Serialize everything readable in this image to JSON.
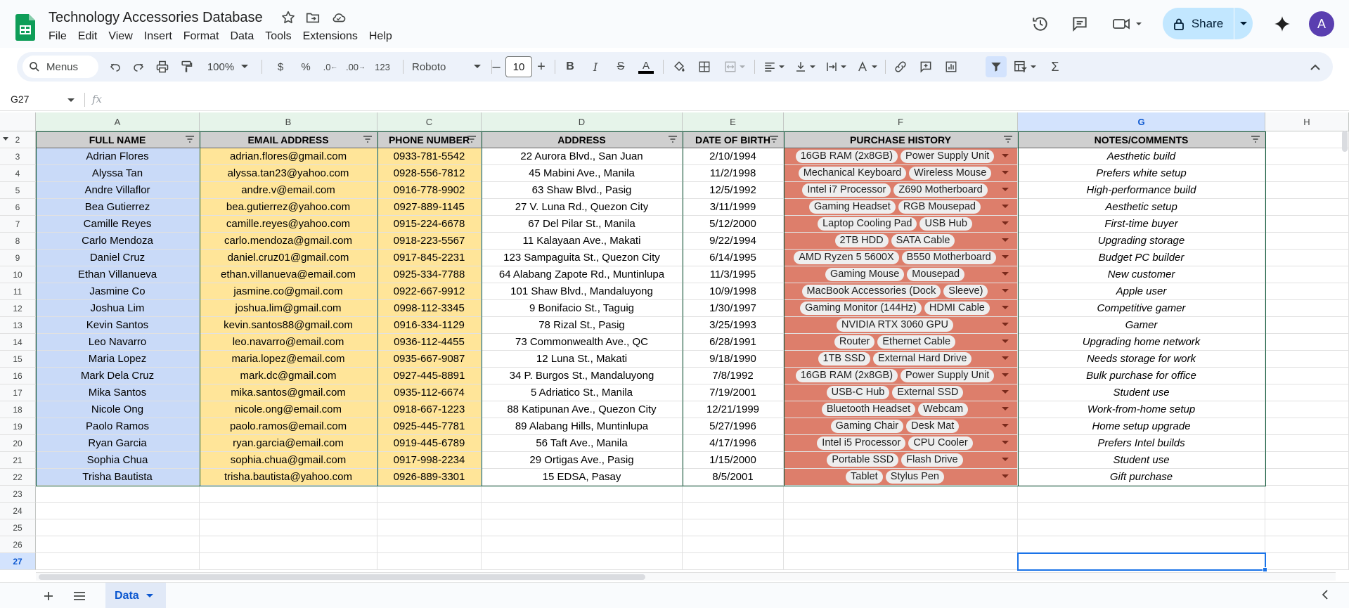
{
  "app": {
    "title": "Technology Accessories Database",
    "menus": [
      "File",
      "Edit",
      "View",
      "Insert",
      "Format",
      "Data",
      "Tools",
      "Extensions",
      "Help"
    ],
    "share_label": "Share",
    "avatar_letter": "A"
  },
  "toolbar": {
    "search_label": "Menus",
    "zoom": "100%",
    "currency": "$",
    "percent": "%",
    "dec_decrease": ".0",
    "dec_increase": ".00",
    "number_format": "123",
    "font": "Roboto",
    "font_size": "10",
    "bold": "B",
    "italic": "I",
    "strike": "S",
    "text_color": "A",
    "sum": "Σ"
  },
  "formula_bar": {
    "name_box": "G27",
    "fx": "fx"
  },
  "grid": {
    "columns": [
      "A",
      "B",
      "C",
      "D",
      "E",
      "F",
      "G",
      "H"
    ],
    "headers": [
      "FULL NAME",
      "EMAIL ADDRESS",
      "PHONE NUMBER",
      "ADDRESS",
      "DATE OF BIRTH",
      "PURCHASE HISTORY",
      "NOTES/COMMENTS"
    ],
    "header_row_number": "2",
    "rows": [
      {
        "num": "3",
        "name": "Adrian Flores",
        "email": "adrian.flores@gmail.com",
        "phone": "0933-781-5542",
        "address": "22 Aurora Blvd., San Juan",
        "dob": "2/10/1994",
        "purchases": [
          "16GB RAM (2x8GB)",
          "Power Supply Unit"
        ],
        "notes": "Aesthetic build"
      },
      {
        "num": "4",
        "name": "Alyssa Tan",
        "email": "alyssa.tan23@yahoo.com",
        "phone": "0928-556-7812",
        "address": "45 Mabini Ave., Manila",
        "dob": "11/2/1998",
        "purchases": [
          "Mechanical Keyboard",
          "Wireless Mouse"
        ],
        "notes": "Prefers white setup"
      },
      {
        "num": "5",
        "name": "Andre Villaflor",
        "email": "andre.v@email.com",
        "phone": "0916-778-9902",
        "address": "63 Shaw Blvd., Pasig",
        "dob": "12/5/1992",
        "purchases": [
          "Intel i7 Processor",
          "Z690 Motherboard"
        ],
        "notes": "High-performance build"
      },
      {
        "num": "6",
        "name": "Bea Gutierrez",
        "email": "bea.gutierrez@yahoo.com",
        "phone": "0927-889-1145",
        "address": "27 V. Luna Rd., Quezon City",
        "dob": "3/11/1999",
        "purchases": [
          "Gaming Headset",
          "RGB Mousepad"
        ],
        "notes": "Aesthetic setup"
      },
      {
        "num": "7",
        "name": "Camille Reyes",
        "email": "camille.reyes@yahoo.com",
        "phone": "0915-224-6678",
        "address": "67 Del Pilar St., Manila",
        "dob": "5/12/2000",
        "purchases": [
          "Laptop Cooling Pad",
          "USB Hub"
        ],
        "notes": "First-time buyer"
      },
      {
        "num": "8",
        "name": "Carlo Mendoza",
        "email": "carlo.mendoza@gmail.com",
        "phone": "0918-223-5567",
        "address": "11 Kalayaan Ave., Makati",
        "dob": "9/22/1994",
        "purchases": [
          "2TB HDD",
          "SATA Cable"
        ],
        "notes": "Upgrading storage"
      },
      {
        "num": "9",
        "name": "Daniel Cruz",
        "email": "daniel.cruz01@gmail.com",
        "phone": "0917-845-2231",
        "address": "123 Sampaguita St., Quezon City",
        "dob": "6/14/1995",
        "purchases": [
          "AMD Ryzen 5 5600X",
          "B550 Motherboard"
        ],
        "notes": "Budget PC builder"
      },
      {
        "num": "10",
        "name": "Ethan Villanueva",
        "email": "ethan.villanueva@email.com",
        "phone": "0925-334-7788",
        "address": "64 Alabang Zapote Rd., Muntinlupa",
        "dob": "11/3/1995",
        "purchases": [
          "Gaming Mouse",
          "Mousepad"
        ],
        "notes": "New customer"
      },
      {
        "num": "11",
        "name": "Jasmine Co",
        "email": "jasmine.co@gmail.com",
        "phone": "0922-667-9912",
        "address": "101 Shaw Blvd., Mandaluyong",
        "dob": "10/9/1998",
        "purchases": [
          "MacBook Accessories (Dock",
          "Sleeve)"
        ],
        "notes": "Apple user"
      },
      {
        "num": "12",
        "name": "Joshua Lim",
        "email": "joshua.lim@gmail.com",
        "phone": "0998-112-3345",
        "address": "9 Bonifacio St., Taguig",
        "dob": "1/30/1997",
        "purchases": [
          "Gaming Monitor (144Hz)",
          "HDMI Cable"
        ],
        "notes": "Competitive gamer"
      },
      {
        "num": "13",
        "name": "Kevin Santos",
        "email": "kevin.santos88@gmail.com",
        "phone": "0916-334-1129",
        "address": "78 Rizal St., Pasig",
        "dob": "3/25/1993",
        "purchases": [
          "NVIDIA RTX 3060 GPU"
        ],
        "notes": "Gamer"
      },
      {
        "num": "14",
        "name": "Leo Navarro",
        "email": "leo.navarro@email.com",
        "phone": "0936-112-4455",
        "address": "73 Commonwealth Ave., QC",
        "dob": "6/28/1991",
        "purchases": [
          "Router",
          "Ethernet Cable"
        ],
        "notes": "Upgrading home network"
      },
      {
        "num": "15",
        "name": "Maria Lopez",
        "email": "maria.lopez@email.com",
        "phone": "0935-667-9087",
        "address": "12 Luna St., Makati",
        "dob": "9/18/1990",
        "purchases": [
          "1TB SSD",
          "External Hard Drive"
        ],
        "notes": "Needs storage for work"
      },
      {
        "num": "16",
        "name": "Mark Dela Cruz",
        "email": "mark.dc@gmail.com",
        "phone": "0927-445-8891",
        "address": "34 P. Burgos St., Mandaluyong",
        "dob": "7/8/1992",
        "purchases": [
          "16GB RAM (2x8GB)",
          "Power Supply Unit"
        ],
        "notes": "Bulk purchase for office"
      },
      {
        "num": "17",
        "name": "Mika Santos",
        "email": "mika.santos@gmail.com",
        "phone": "0935-112-6674",
        "address": "5 Adriatico St., Manila",
        "dob": "7/19/2001",
        "purchases": [
          "USB-C Hub",
          "External SSD"
        ],
        "notes": "Student use"
      },
      {
        "num": "18",
        "name": "Nicole Ong",
        "email": "nicole.ong@email.com",
        "phone": "0918-667-1223",
        "address": "88 Katipunan Ave., Quezon City",
        "dob": "12/21/1999",
        "purchases": [
          "Bluetooth Headset",
          "Webcam"
        ],
        "notes": "Work-from-home setup"
      },
      {
        "num": "19",
        "name": "Paolo Ramos",
        "email": "paolo.ramos@email.com",
        "phone": "0925-445-7781",
        "address": "89 Alabang Hills, Muntinlupa",
        "dob": "5/27/1996",
        "purchases": [
          "Gaming Chair",
          "Desk Mat"
        ],
        "notes": "Home setup upgrade"
      },
      {
        "num": "20",
        "name": "Ryan Garcia",
        "email": "ryan.garcia@email.com",
        "phone": "0919-445-6789",
        "address": "56 Taft Ave., Manila",
        "dob": "4/17/1996",
        "purchases": [
          "Intel i5 Processor",
          "CPU Cooler"
        ],
        "notes": "Prefers Intel builds"
      },
      {
        "num": "21",
        "name": "Sophia Chua",
        "email": "sophia.chua@gmail.com",
        "phone": "0917-998-2234",
        "address": "29 Ortigas Ave., Pasig",
        "dob": "1/15/2000",
        "purchases": [
          "Portable SSD",
          "Flash Drive"
        ],
        "notes": "Student use"
      },
      {
        "num": "22",
        "name": "Trisha Bautista",
        "email": "trisha.bautista@yahoo.com",
        "phone": "0926-889-3301",
        "address": "15 EDSA, Pasay",
        "dob": "8/5/2001",
        "purchases": [
          "Tablet",
          "Stylus Pen"
        ],
        "notes": "Gift purchase"
      }
    ],
    "empty_rows": [
      "23",
      "24",
      "25",
      "26",
      "27"
    ],
    "selected_row": "27"
  },
  "tabs": [
    {
      "label": "Data"
    }
  ],
  "colors": {
    "name_fill": "#c9daf8",
    "contact_fill": "#ffe599",
    "purchase_fill": "#dd7e6b",
    "header_fill": "#cfcfcf",
    "selection": "#1a73e8",
    "share_button": "#c2e7ff"
  }
}
